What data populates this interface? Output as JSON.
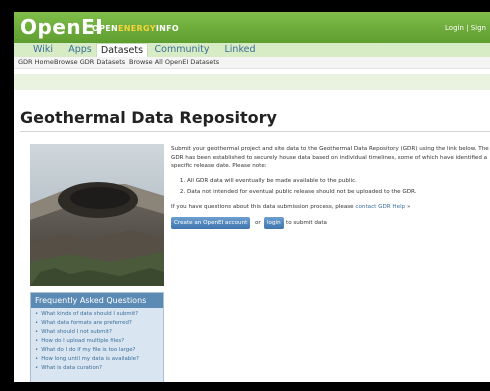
{
  "header": {
    "logo_main": "OpenEI",
    "logo_open": "OPEN",
    "logo_energy": "ENERGY",
    "logo_info": "INFO",
    "top_links": "Login | Sign"
  },
  "tabs": [
    {
      "label": "Wiki"
    },
    {
      "label": "Apps"
    },
    {
      "label": "Datasets"
    },
    {
      "label": "Community"
    },
    {
      "label": "Linked Data"
    }
  ],
  "subnav": [
    {
      "label": "GDR Home"
    },
    {
      "label": "Browse GDR Datasets"
    },
    {
      "label": "Browse All OpenEI Datasets"
    }
  ],
  "page": {
    "title": "Geothermal Data Repository",
    "intro": "Submit your geothermal project and site data to the Geothermal Data Repository (GDR) using the link below. The GDR has been established to securely house data based on individual timelines, some of which have identified a specific release date. Please note:",
    "notes": [
      "All GDR data will eventually be made available to the public.",
      "Data not intended for eventual public release should not be uploaded to the GDR."
    ],
    "question_prefix": "If you have questions about this data submission process, please",
    "question_link": "contact GDR Help",
    "question_suffix": "»",
    "create_account_button": "Create an OpenEI account",
    "or_text": "or",
    "login_button": "login",
    "to_submit_text": "to submit data"
  },
  "faq": {
    "title": "Frequently Asked Questions",
    "items": [
      "What kinds of data should I submit?",
      "What data formats are preferred?",
      "What should I not submit?",
      "How do I upload multiple files?",
      "What do I do if my file is too large?",
      "How long until my data is available?",
      "What is data curation?"
    ]
  },
  "colors": {
    "header_green": "#6fb03c",
    "tab_bar": "#d7ecc4",
    "link_blue": "#3b6e9a",
    "faq_header": "#5b8ab5"
  }
}
